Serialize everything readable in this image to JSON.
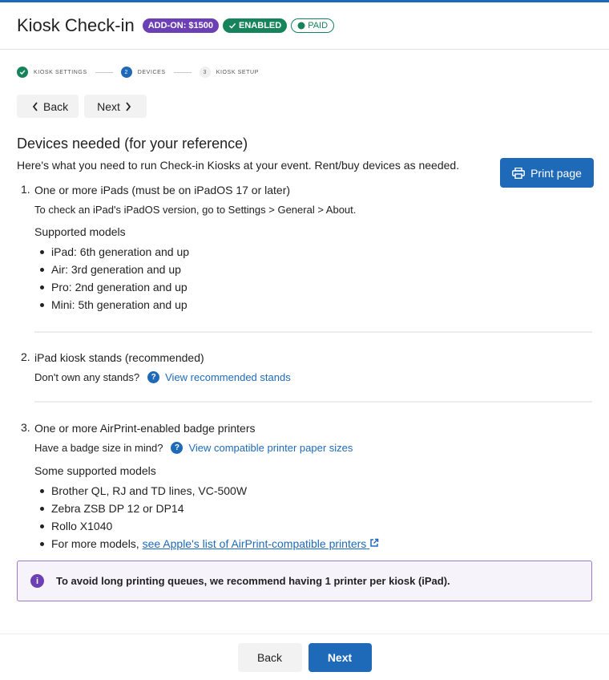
{
  "header": {
    "title": "Kiosk Check-in",
    "badges": {
      "addon": "ADD-ON: $1500",
      "enabled": "ENABLED",
      "paid": "PAID"
    }
  },
  "stepper": [
    {
      "num": "",
      "label": "KIOSK SETTINGS",
      "state": "done"
    },
    {
      "num": "2",
      "label": "DEVICES",
      "state": "active"
    },
    {
      "num": "3",
      "label": "KIOSK SETUP",
      "state": "idle"
    }
  ],
  "nav": {
    "back": "Back",
    "next": "Next"
  },
  "main": {
    "title": "Devices needed (for your reference)",
    "intro": "Here's what you need to run Check-in Kiosks at your event. Rent/buy devices as needed.",
    "print_label": "Print page",
    "items": [
      {
        "num": "1.",
        "title": "One or more iPads (must be on iPadOS 17 or later)",
        "note": "To check an iPad's iPadOS version, go to Settings > General > About.",
        "models_heading": "Supported models",
        "models": [
          "iPad: 6th generation and up",
          "Air: 3rd generation and up",
          "Pro: 2nd generation and up",
          "Mini: 5th generation and up"
        ]
      },
      {
        "num": "2.",
        "title": "iPad kiosk stands (recommended)",
        "note": "Don't own any stands?",
        "link": "View recommended stands"
      },
      {
        "num": "3.",
        "title": "One or more AirPrint-enabled badge printers",
        "note": "Have a badge size in mind?",
        "link": "View compatible printer paper sizes",
        "models_heading": "Some supported models",
        "models": [
          "Brother QL, RJ and TD lines, VC-500W",
          "Zebra ZSB DP 12 or DP14",
          "Rollo X1040"
        ],
        "more_prefix": "For more models,",
        "more_link": "see Apple's list of AirPrint-compatible printers"
      }
    ],
    "info": "To avoid long printing queues, we recommend having 1 printer per kiosk (iPad)."
  },
  "footer": {
    "back": "Back",
    "next": "Next"
  },
  "colors": {
    "primary": "#1e6ab8",
    "success": "#17835a",
    "accent": "#6c3fb5"
  }
}
